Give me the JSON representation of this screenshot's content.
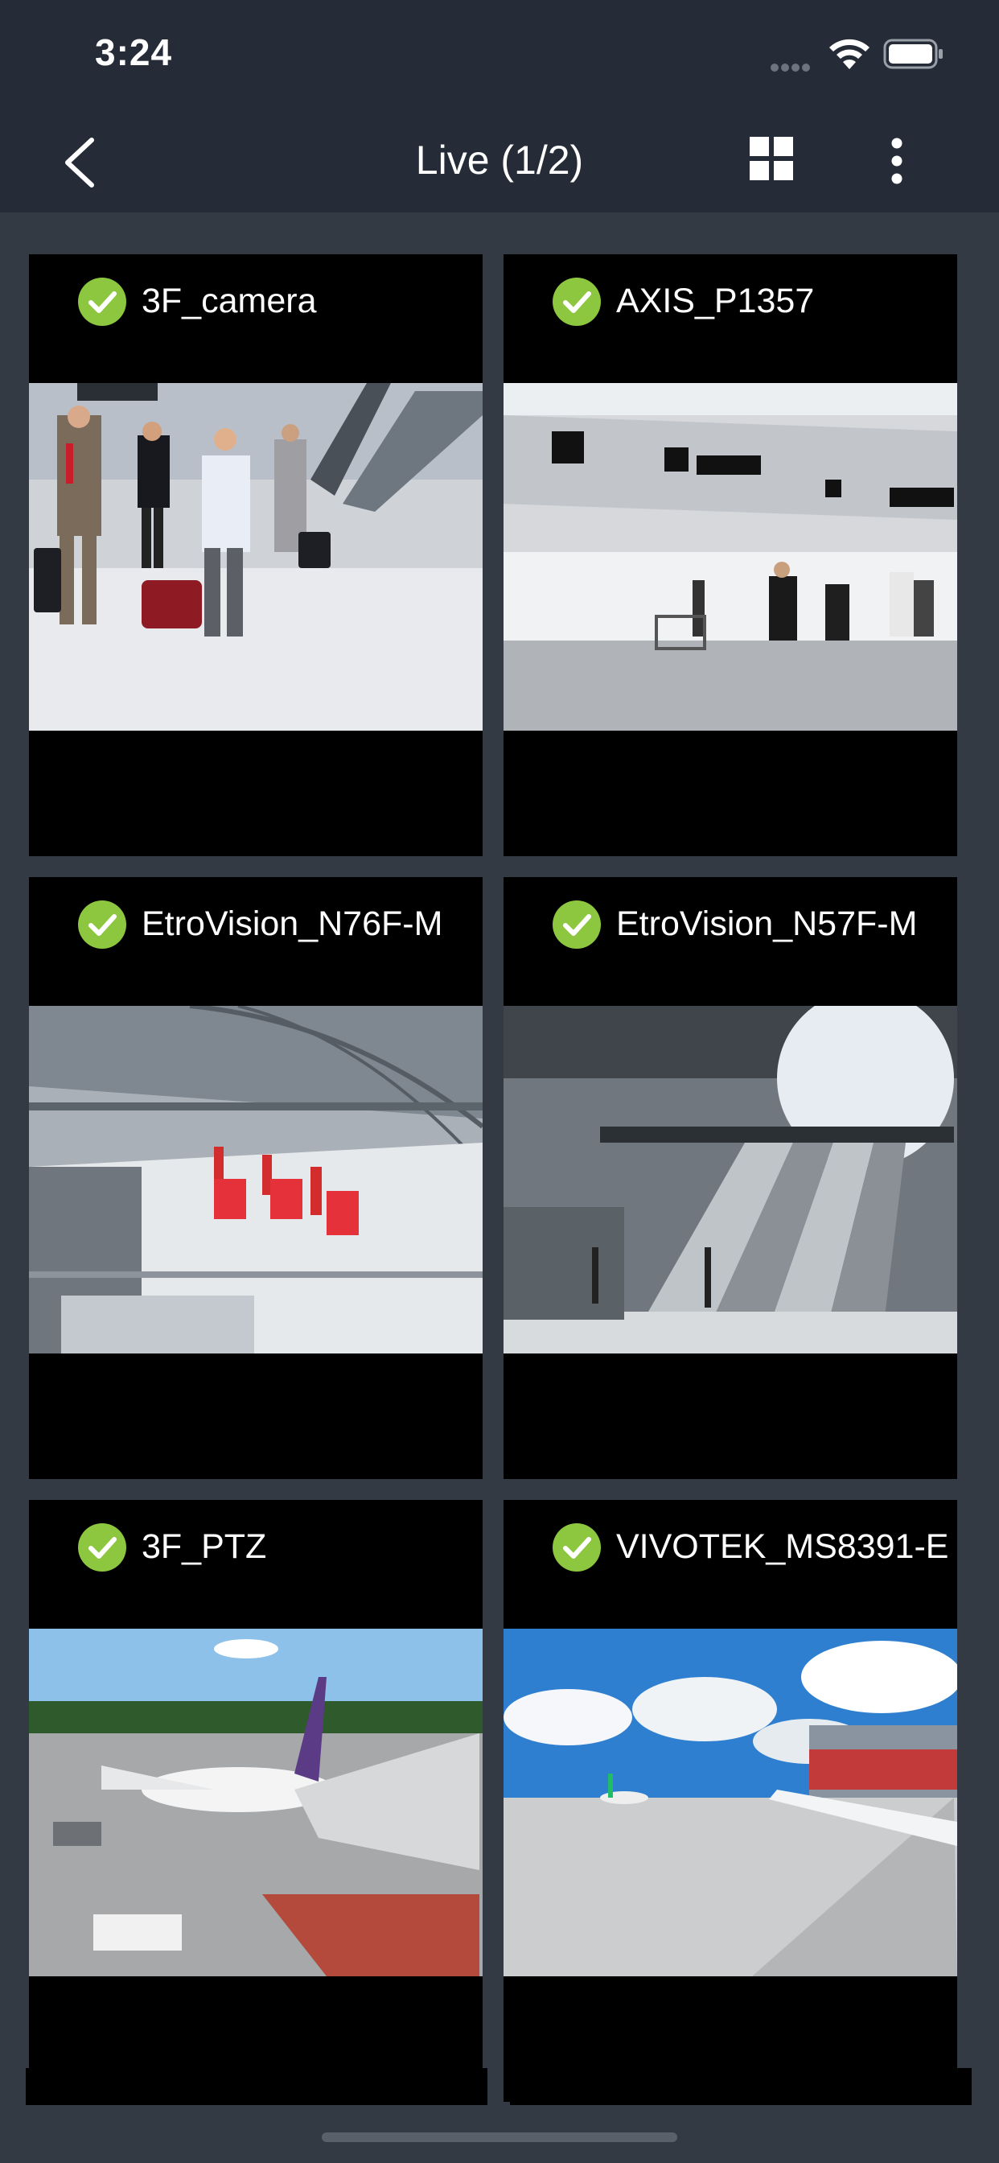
{
  "status_bar": {
    "time": "3:24"
  },
  "nav": {
    "title": "Live (1/2)",
    "back_icon": "back-icon",
    "grid_icon": "grid-view-icon",
    "more_icon": "more-vertical-icon"
  },
  "cameras": [
    {
      "name": "3F_camera",
      "status": "online",
      "scene": "travelers walking through terminal with luggage"
    },
    {
      "name": "AXIS_P1357",
      "status": "online",
      "scene": "airport check-in counters"
    },
    {
      "name": "EtroVision_N76F-M",
      "status": "online",
      "scene": "glass terminal with red seating"
    },
    {
      "name": "EtroVision_N57F-M",
      "status": "online",
      "scene": "escalators in terminal"
    },
    {
      "name": "3F_PTZ",
      "status": "online",
      "scene": "airplane at gate with jet bridge"
    },
    {
      "name": "VIVOTEK_MS8391-E",
      "status": "online",
      "scene": "airport apron under blue sky"
    }
  ],
  "colors": {
    "background": "#333a44",
    "header": "#252c38",
    "online": "#8dc63f",
    "tile": "#000000"
  }
}
